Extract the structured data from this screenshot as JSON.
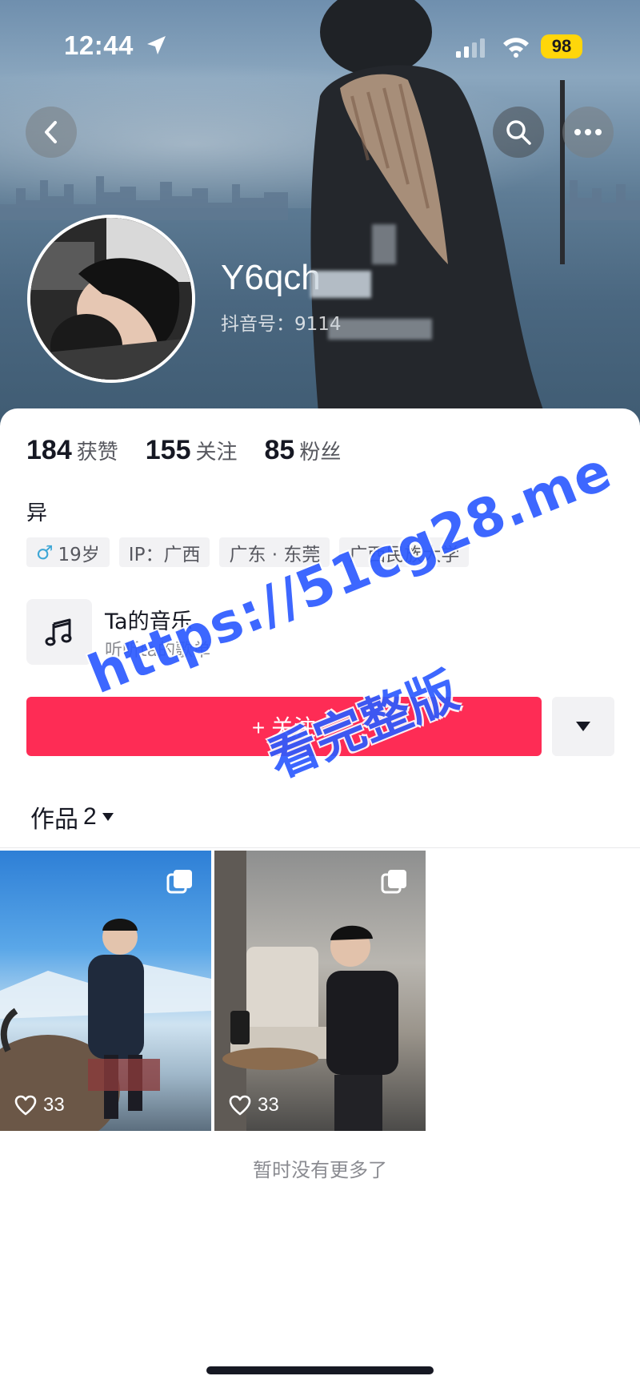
{
  "status_bar": {
    "time": "12:44",
    "battery": "98"
  },
  "profile": {
    "username": "Y6qch",
    "douyin_id": "抖音号：9114",
    "stats": [
      {
        "value": "184",
        "label": "获赞"
      },
      {
        "value": "155",
        "label": "关注"
      },
      {
        "value": "85",
        "label": "粉丝"
      }
    ],
    "bio": "异",
    "tags": [
      "19岁",
      "IP：广西",
      "广东 · 东莞",
      "广西民族大学"
    ]
  },
  "music": {
    "title": "Ta的音乐",
    "subtitle": "听听ta的歌单"
  },
  "actions": {
    "follow_label": "+ 关注"
  },
  "works": {
    "tab_label": "作品",
    "count": "2",
    "items": [
      {
        "likes": "33"
      },
      {
        "likes": "33"
      }
    ],
    "end_text": "暂时没有更多了"
  },
  "watermark": {
    "url": "https://51cg28.me",
    "text": "看完整版"
  },
  "colors": {
    "accent": "#fe2c55",
    "watermark": "#2d5bff",
    "battery": "#ffd60a"
  }
}
